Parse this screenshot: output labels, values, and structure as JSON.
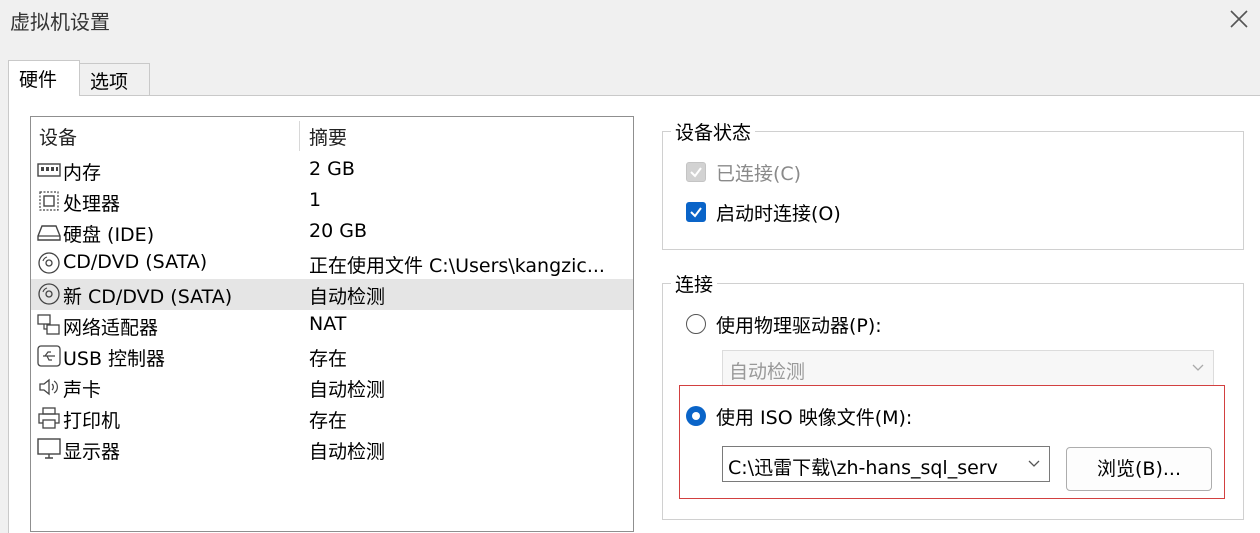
{
  "window": {
    "title": "虚拟机设置"
  },
  "tabs": [
    {
      "label": "硬件"
    },
    {
      "label": "选项"
    }
  ],
  "device_list": {
    "headers": {
      "device": "设备",
      "summary": "摘要"
    },
    "rows": [
      {
        "icon": "memory-icon",
        "name": "内存",
        "summary": "2 GB"
      },
      {
        "icon": "processor-icon",
        "name": "处理器",
        "summary": "1"
      },
      {
        "icon": "hard-disk-icon",
        "name": "硬盘 (IDE)",
        "summary": "20 GB"
      },
      {
        "icon": "cd-dvd-icon",
        "name": "CD/DVD (SATA)",
        "summary": "正在使用文件 C:\\Users\\kangzic..."
      },
      {
        "icon": "cd-dvd-icon",
        "name": "新 CD/DVD (SATA)",
        "summary": "自动检测",
        "selected": true
      },
      {
        "icon": "network-adapter-icon",
        "name": "网络适配器",
        "summary": "NAT"
      },
      {
        "icon": "usb-controller-icon",
        "name": "USB 控制器",
        "summary": "存在"
      },
      {
        "icon": "sound-card-icon",
        "name": "声卡",
        "summary": "自动检测"
      },
      {
        "icon": "printer-icon",
        "name": "打印机",
        "summary": "存在"
      },
      {
        "icon": "display-icon",
        "name": "显示器",
        "summary": "自动检测"
      }
    ]
  },
  "device_status": {
    "legend": "设备状态",
    "connected": {
      "label": "已连接(C)",
      "checked": true,
      "disabled": true
    },
    "connect_at_power_on": {
      "label": "启动时连接(O)",
      "checked": true
    }
  },
  "connection": {
    "legend": "连接",
    "physical_drive": {
      "label": "使用物理驱动器(P):",
      "selected": false,
      "value": "自动检测"
    },
    "iso_image": {
      "label": "使用 ISO 映像文件(M):",
      "selected": true,
      "path": "C:\\迅雷下载\\zh-hans_sql_serv"
    },
    "browse_button": "浏览(B)..."
  },
  "colors": {
    "accent": "#0a64c8",
    "highlight_border": "#d24040",
    "selected_row": "#e5e5e5"
  }
}
